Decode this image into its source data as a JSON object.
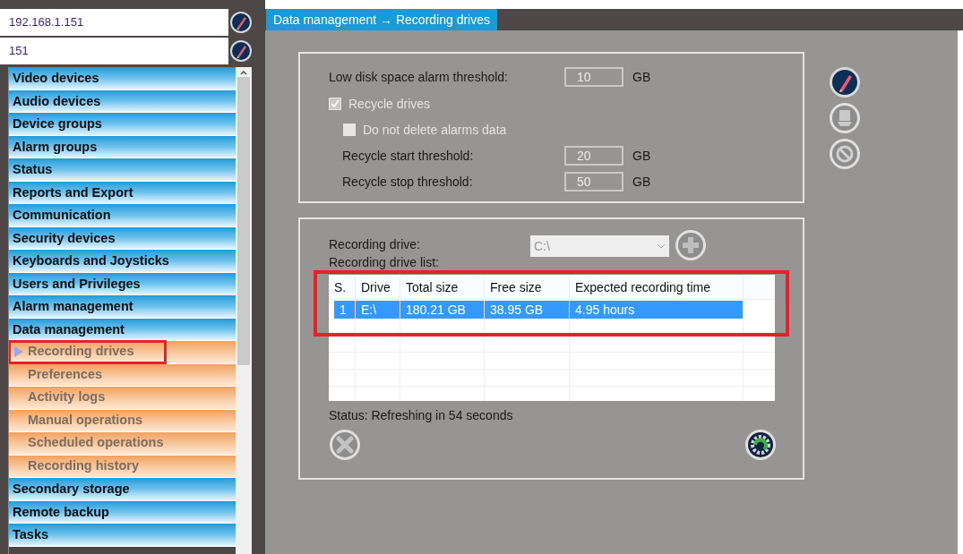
{
  "connection": {
    "address": "192.168.1.151",
    "port": "151"
  },
  "menu": [
    {
      "label": "Video devices"
    },
    {
      "label": "Audio devices"
    },
    {
      "label": "Device groups"
    },
    {
      "label": "Alarm groups"
    },
    {
      "label": "Status"
    },
    {
      "label": "Reports and Export"
    },
    {
      "label": "Communication"
    },
    {
      "label": "Security devices"
    },
    {
      "label": "Keyboards and Joysticks"
    },
    {
      "label": "Users and Privileges"
    },
    {
      "label": "Alarm management"
    },
    {
      "label": "Data management",
      "children": [
        {
          "label": "Recording drives",
          "selected": true,
          "highlighted": true
        },
        {
          "label": "Preferences",
          "selected": false,
          "highlighted": false
        },
        {
          "label": "Activity logs",
          "selected": false,
          "highlighted": false
        },
        {
          "label": "Manual operations",
          "selected": false,
          "highlighted": false
        },
        {
          "label": "Scheduled operations",
          "selected": false,
          "highlighted": false
        },
        {
          "label": "Recording history",
          "selected": false,
          "highlighted": false
        }
      ]
    },
    {
      "label": "Secondary storage"
    },
    {
      "label": "Remote backup"
    },
    {
      "label": "Tasks"
    }
  ],
  "breadcrumb": "Data management → Recording drives",
  "settings": {
    "low_disk": {
      "label": "Low disk space alarm threshold:",
      "value": "10",
      "unit": "GB"
    },
    "recycle": {
      "label": "Recycle drives",
      "checked": true
    },
    "keep_alarms": {
      "label": "Do not delete alarms data",
      "checked": false
    },
    "start": {
      "label": "Recycle start threshold:",
      "value": "20",
      "unit": "GB"
    },
    "stop": {
      "label": "Recycle stop threshold:",
      "value": "50",
      "unit": "GB"
    }
  },
  "drives": {
    "drive_label": "Recording drive:",
    "drive_value": "C:\\",
    "list_label": "Recording drive list:",
    "table": {
      "highlighted": true,
      "columns": [
        "S.",
        "Drive",
        "Total size",
        "Free size",
        "Expected recording time"
      ],
      "rows": [
        {
          "cells": [
            "1",
            "E:\\",
            "180.21 GB",
            "38.95 GB",
            "4.95 hours"
          ],
          "selected": true
        }
      ]
    },
    "status": "Status: Refreshing in 54 seconds"
  }
}
